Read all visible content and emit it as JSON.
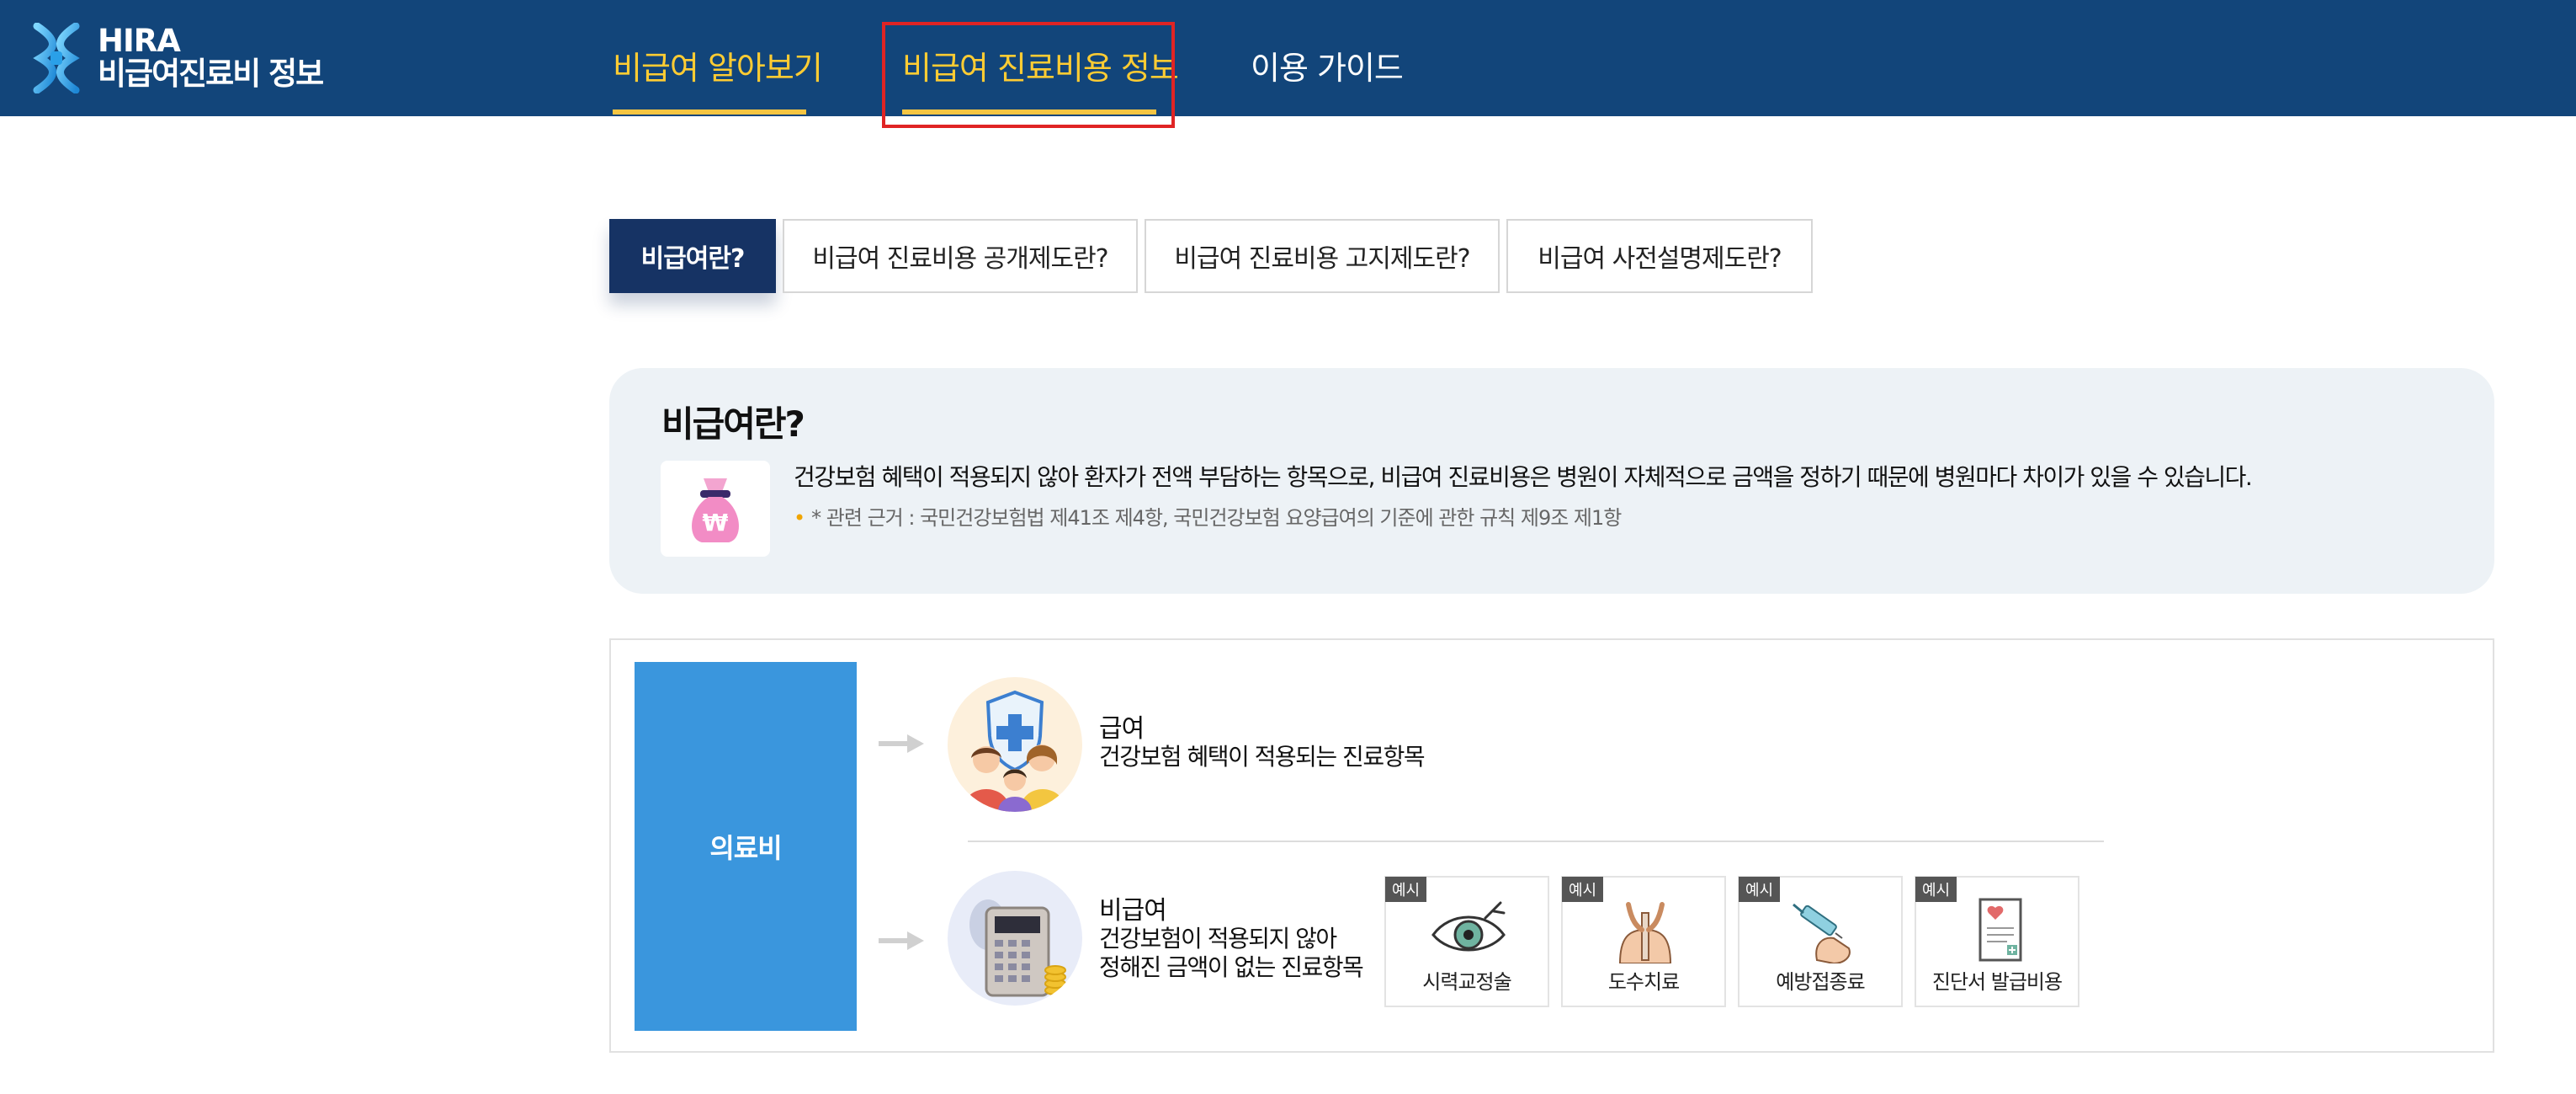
{
  "header": {
    "logo_en": "HIRA",
    "logo_ko": "비급여진료비 정보",
    "nav": [
      {
        "label": "비급여 알아보기",
        "active": true
      },
      {
        "label": "비급여 진료비용 정보",
        "active": true
      },
      {
        "label": "이용 가이드",
        "active": false
      }
    ]
  },
  "tabs": [
    {
      "label": "비급여란?",
      "active": true
    },
    {
      "label": "비급여 진료비용 공개제도란?",
      "active": false
    },
    {
      "label": "비급여 진료비용 고지제도란?",
      "active": false
    },
    {
      "label": "비급여 사전설명제도란?",
      "active": false
    }
  ],
  "info": {
    "title": "비급여란?",
    "icon": "money-bag-won-icon",
    "description": "건강보험 혜택이 적용되지 않아 환자가 전액 부담하는 항목으로, 비급여 진료비용은 병원이 자체적으로 금액을 정하기 때문에 병원마다 차이가 있을 수 있습니다.",
    "note": "* 관련 근거 : 국민건강보험법 제41조 제4항, 국민건강보험 요양급여의 기준에 관한 규칙 제9조 제1항"
  },
  "diagram": {
    "root_label": "의료비",
    "covered": {
      "title": "급여",
      "desc": "건강보험 혜택이 적용되는 진료항목"
    },
    "uncovered": {
      "title": "비급여",
      "desc_line1": "건강보험이 적용되지 않아",
      "desc_line2": "정해진 금액이 없는 진료항목"
    },
    "example_badge": "예시",
    "examples": [
      {
        "label": "시력교정술",
        "icon": "eye-surgery-icon"
      },
      {
        "label": "도수치료",
        "icon": "manual-therapy-icon"
      },
      {
        "label": "예방접종료",
        "icon": "vaccine-syringe-icon"
      },
      {
        "label": "진단서 발급비용",
        "icon": "medical-certificate-icon"
      }
    ]
  },
  "colors": {
    "header_bg": "#12457a",
    "nav_gold": "#ffcc33",
    "tab_active": "#163364",
    "root_block": "#3a96dd",
    "highlight": "#e02424"
  }
}
